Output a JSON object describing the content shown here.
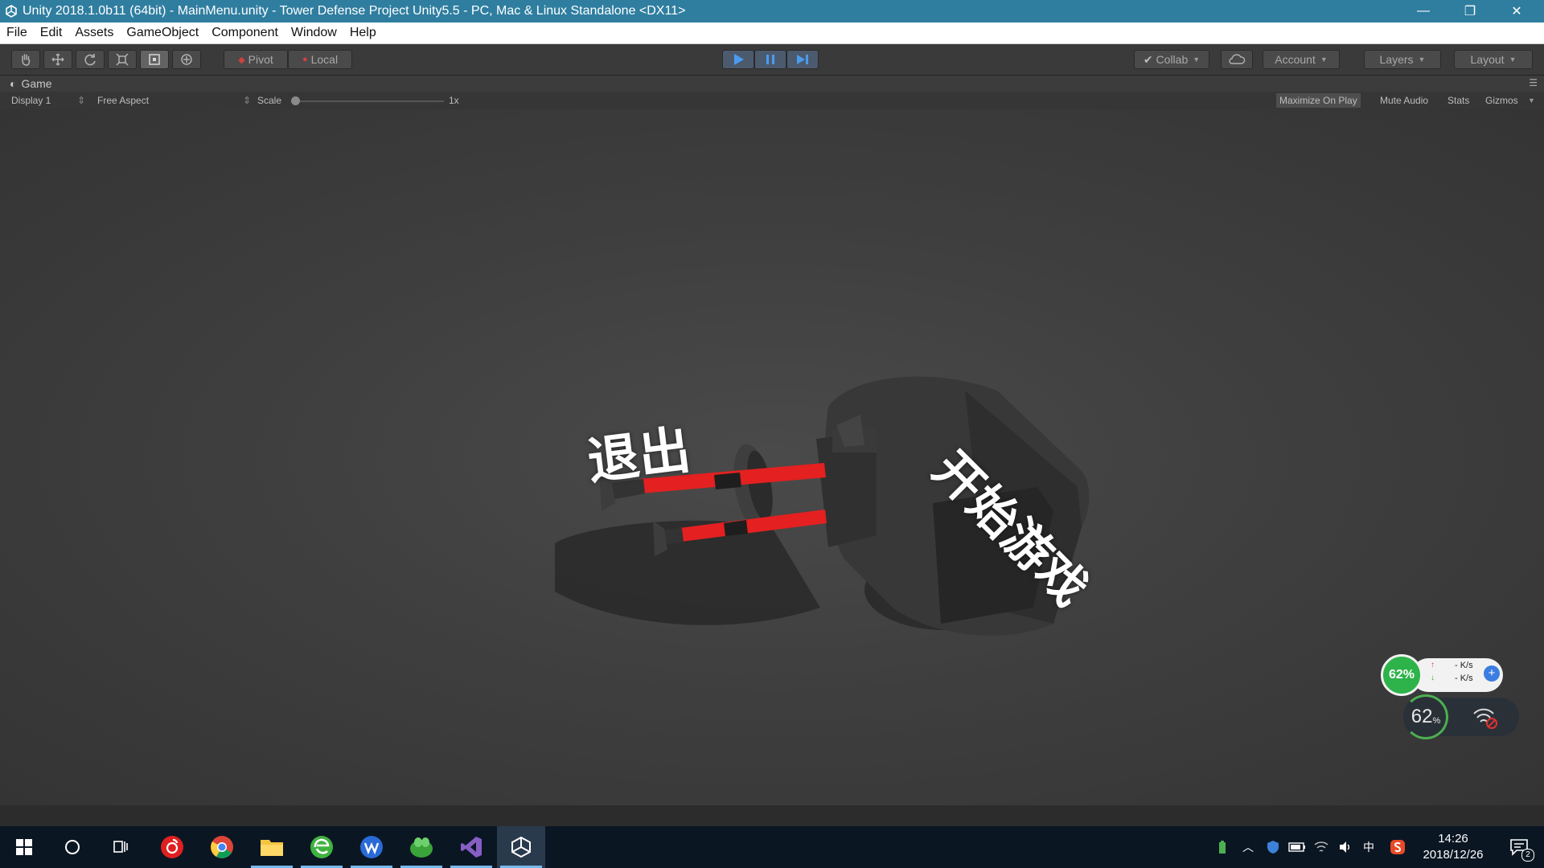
{
  "window": {
    "title": "Unity 2018.1.0b11 (64bit) - MainMenu.unity - Tower Defense Project Unity5.5 - PC, Mac & Linux Standalone <DX11>",
    "controls": {
      "minimize": "—",
      "restore": "❐",
      "close": "✕"
    }
  },
  "menu": [
    "File",
    "Edit",
    "Assets",
    "GameObject",
    "Component",
    "Window",
    "Help"
  ],
  "toolbar": {
    "tools": [
      "hand-icon",
      "move-icon",
      "rotate-icon",
      "scale-icon",
      "rect-tool-icon",
      "transform-icon"
    ],
    "pivot_label": "Pivot",
    "local_label": "Local",
    "collab_label": "Collab",
    "account_label": "Account",
    "layers_label": "Layers",
    "layout_label": "Layout"
  },
  "game_tab": {
    "label": "Game",
    "display": "Display 1",
    "aspect": "Free Aspect",
    "scale_label": "Scale",
    "scale_value": "1x",
    "maximize_on_play": "Maximize On Play",
    "mute_audio": "Mute Audio",
    "stats": "Stats",
    "gizmos": "Gizmos"
  },
  "scene": {
    "quit_text": "退出",
    "start_text": "开始游戏"
  },
  "net_widget": {
    "percent": "62%",
    "up_speed": "- K/s",
    "down_speed": "- K/s",
    "big_value": "62",
    "big_unit": "%"
  },
  "taskbar": {
    "apps": [
      "windows-start-icon",
      "cortana-icon",
      "task-view-icon",
      "netease-music-icon",
      "chrome-icon",
      "file-explorer-icon",
      "browser-icon",
      "wps-icon",
      "green-app-icon",
      "visual-studio-icon",
      "unity-icon"
    ],
    "time": "14:26",
    "date": "2018/12/26",
    "ime": "中",
    "notification_count": "2"
  },
  "colors": {
    "titlebar": "#2f7ea0",
    "toolbar": "#3a3a3a",
    "play_accent": "#4a9cf0",
    "turret_red": "#e42020",
    "widget_green": "#2db34a"
  }
}
